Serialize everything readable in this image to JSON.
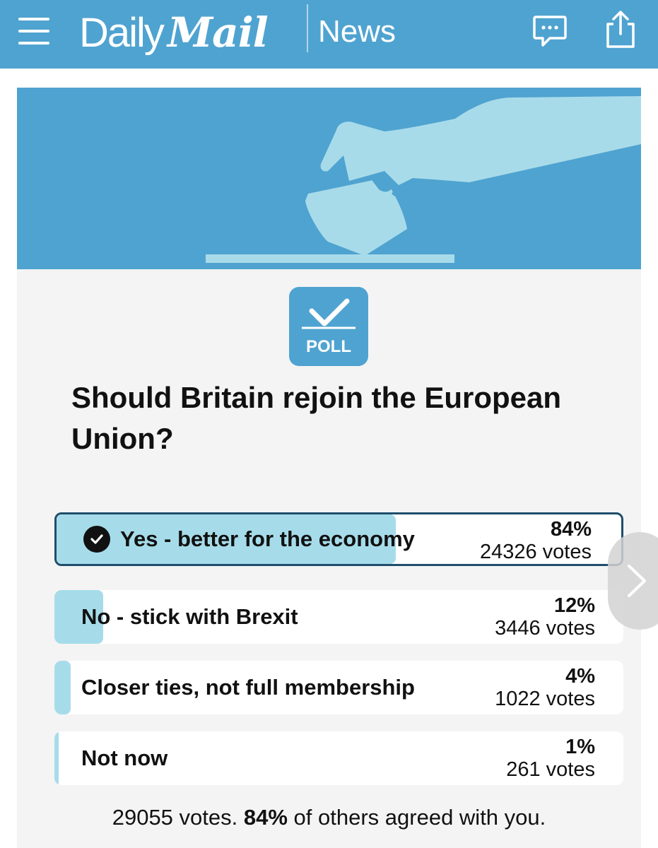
{
  "header": {
    "menu_icon": "hamburger-menu-icon",
    "logo_left": "Daily",
    "logo_right": "Mail",
    "section": "News",
    "comment_icon": "comment-bubble-icon",
    "share_icon": "share-icon",
    "background_color": "#4fa3d0"
  },
  "poll": {
    "badge_label": "POLL",
    "question": "Should Britain rejoin the European Union?",
    "accent_color": "#a6dcea",
    "options": [
      {
        "label": "Yes - better for the economy",
        "percent": "84%",
        "votes": "24326 votes",
        "share": 0.84,
        "selected": true
      },
      {
        "label": "No - stick with Brexit",
        "percent": "12%",
        "votes": "3446 votes",
        "share": 0.12,
        "selected": false
      },
      {
        "label": "Closer ties, not full membership",
        "percent": "4%",
        "votes": "1022 votes",
        "share": 0.04,
        "selected": false
      },
      {
        "label": "Not now",
        "percent": "1%",
        "votes": "261 votes",
        "share": 0.01,
        "selected": false
      }
    ],
    "summary": {
      "total": "29055 votes.",
      "agree_pct": "84%",
      "agree_text": "of others agreed with you."
    }
  }
}
